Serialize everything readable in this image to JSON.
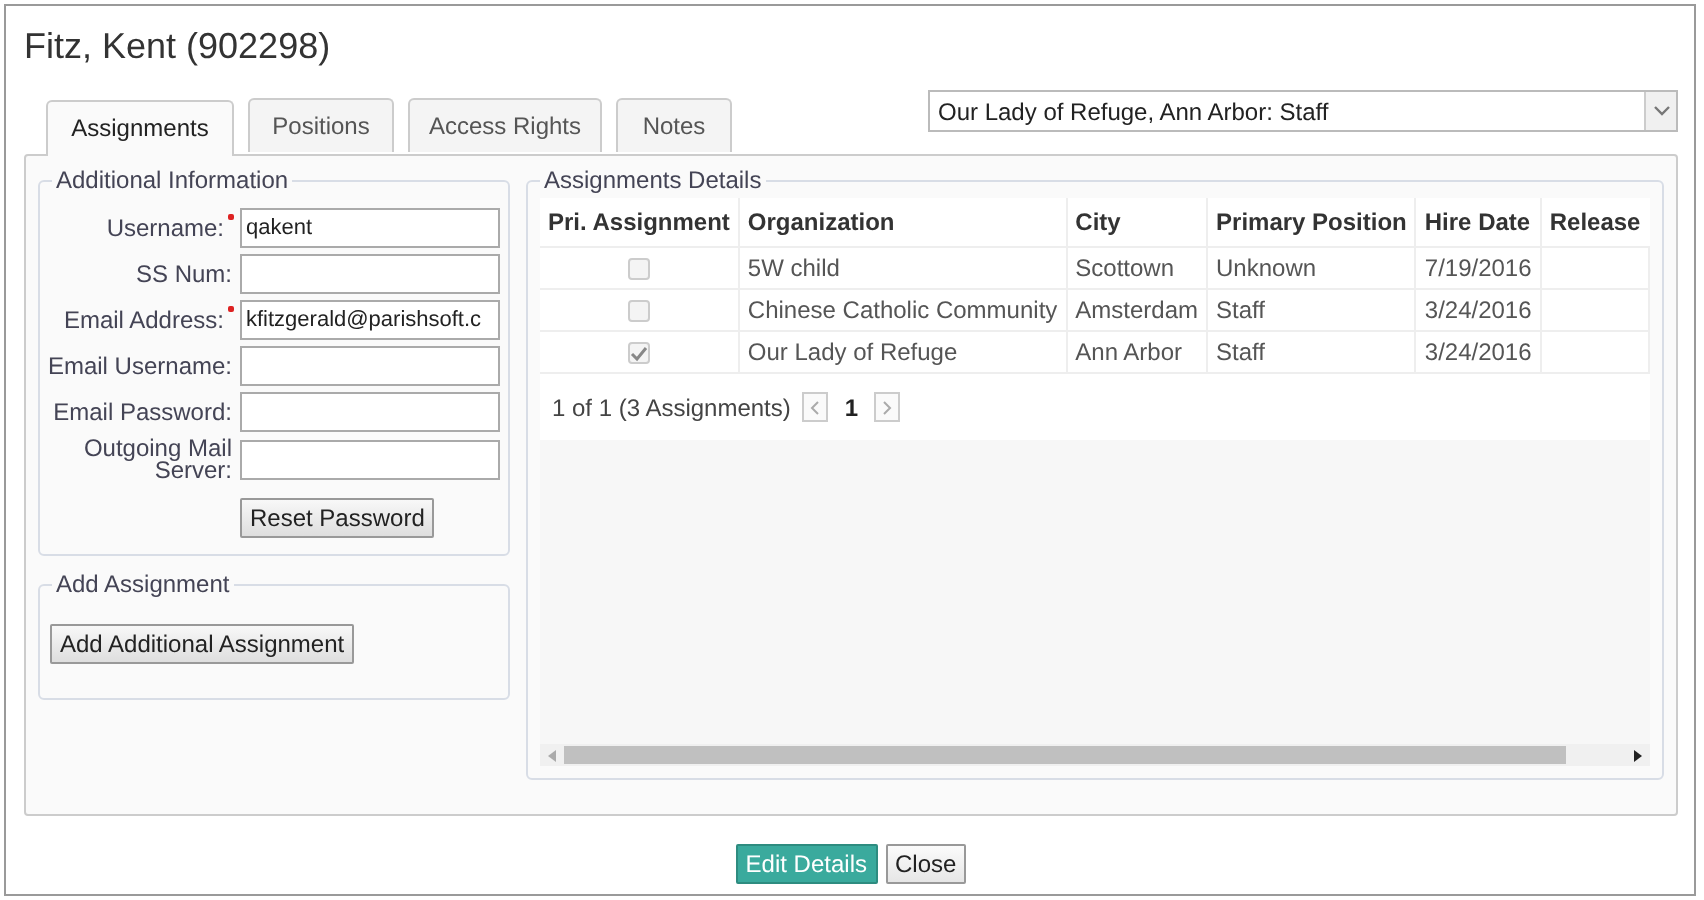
{
  "window": {
    "title": "Fitz, Kent (902298)"
  },
  "tabs": [
    {
      "label": "Assignments",
      "selected": true
    },
    {
      "label": "Positions",
      "selected": false
    },
    {
      "label": "Access Rights",
      "selected": false
    },
    {
      "label": "Notes",
      "selected": false
    }
  ],
  "assignment_select": {
    "value": "Our Lady of Refuge, Ann Arbor: Staff"
  },
  "additional_information": {
    "legend": "Additional Information",
    "fields": [
      {
        "label": "Username:",
        "required": true,
        "value": "qakent"
      },
      {
        "label": "SS Num:",
        "required": false
      },
      {
        "label": "Email Address:",
        "required": true,
        "value": "kfitzgerald@parishsoft.c"
      },
      {
        "label": "Email Username:",
        "required": false
      },
      {
        "label": "Email Password:",
        "required": false
      },
      {
        "label": "Outgoing Mail Server:",
        "required": false
      }
    ],
    "button": "Reset Password"
  },
  "add_assignment": {
    "legend": "Add Assignment",
    "button": "Add Additional Assignment"
  },
  "assignments_details": {
    "legend": "Assignments Details",
    "table": {
      "columns": [
        "Pri. Assignment",
        "Organization",
        "City",
        "Primary Position",
        "Hire Date",
        "Release"
      ],
      "rows": [
        {
          "checked": false,
          "cells": [
            "",
            "5W child",
            "Scottown",
            "Unknown",
            "7/19/2016",
            ""
          ]
        },
        {
          "checked": false,
          "cells": [
            "",
            "Chinese Catholic Community",
            "Amsterdam",
            "Staff",
            "3/24/2016",
            ""
          ]
        },
        {
          "checked": true,
          "cells": [
            "",
            "Our Lady of Refuge",
            "Ann Arbor",
            "Staff",
            "3/24/2016",
            ""
          ]
        }
      ]
    },
    "pager": {
      "summary": "1 of 1 (3 Assignments)",
      "pages": [
        {
          "label": "1",
          "selected": true
        }
      ]
    }
  },
  "buttons": [
    {
      "label": "Edit Details",
      "kind": "primary"
    },
    {
      "label": "Close",
      "kind": "plain"
    }
  ]
}
